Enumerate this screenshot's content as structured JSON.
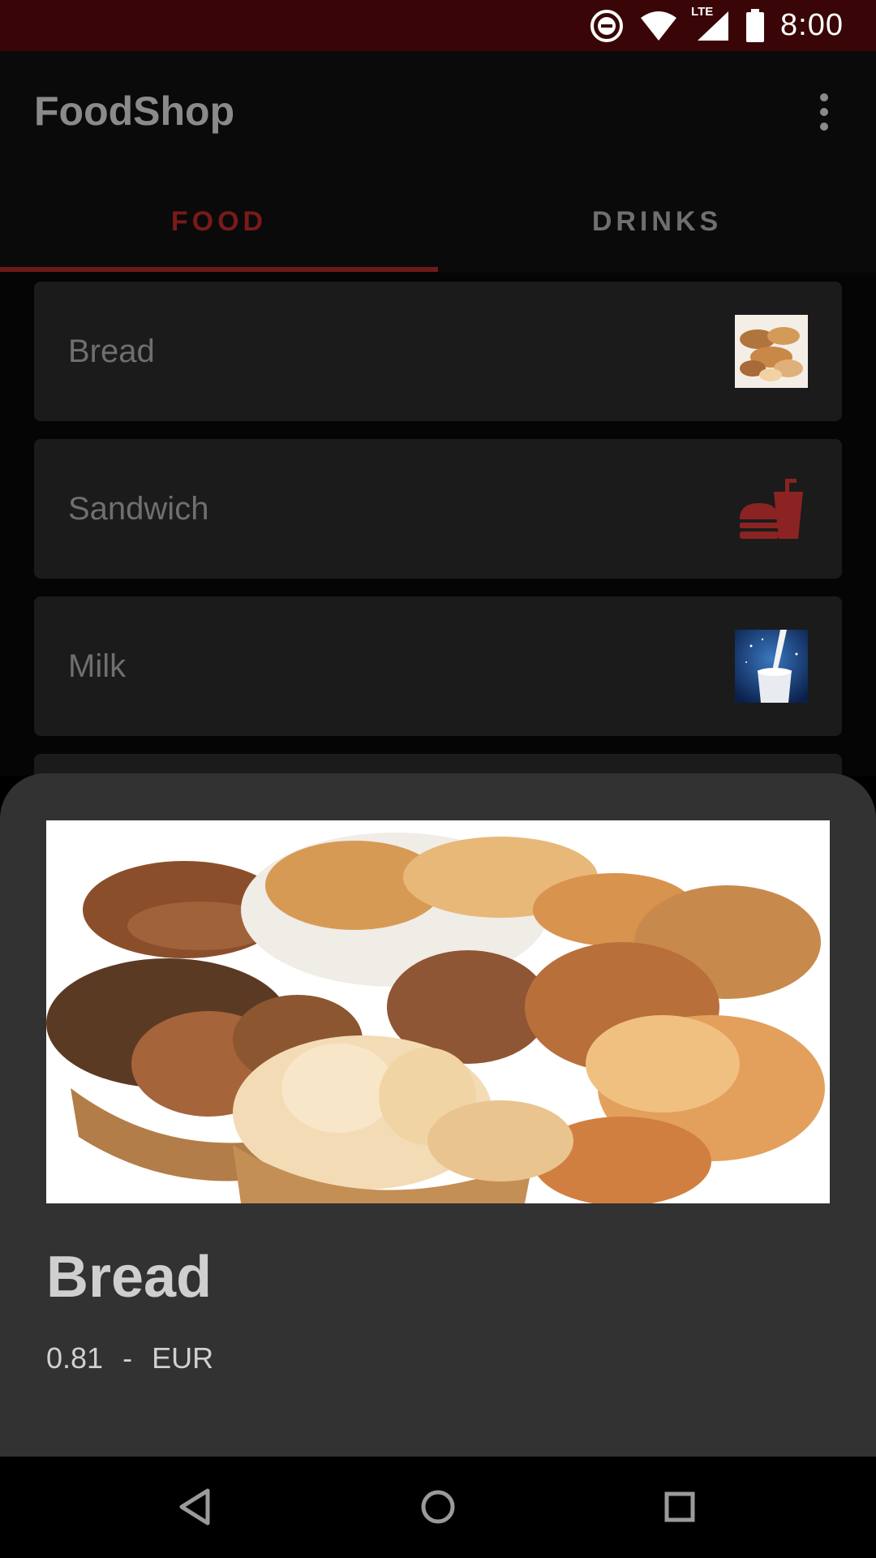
{
  "status_bar": {
    "time": "8:00",
    "icons": [
      "do-not-disturb-icon",
      "wifi-icon",
      "lte-signal-icon",
      "battery-icon"
    ],
    "network_label": "LTE"
  },
  "app_bar": {
    "title": "FoodShop",
    "menu_icon": "more-vert-icon"
  },
  "tabs": [
    {
      "label": "FOOD",
      "selected": true
    },
    {
      "label": "DRINKS",
      "selected": false
    }
  ],
  "items": [
    {
      "label": "Bread",
      "icon": "bread-thumbnail"
    },
    {
      "label": "Sandwich",
      "icon": "fastfood-icon"
    },
    {
      "label": "Milk",
      "icon": "milk-thumbnail"
    }
  ],
  "detail": {
    "title": "Bread",
    "price": "0.81",
    "separator": "-",
    "currency": "EUR",
    "image": "bread-assortment-image"
  },
  "nav_bar": [
    "back-icon",
    "home-icon",
    "recents-icon"
  ],
  "colors": {
    "accent": "#7a1a1a",
    "status_bar": "#3a0506",
    "card": "#1b1b1b",
    "sheet": "#323232"
  }
}
